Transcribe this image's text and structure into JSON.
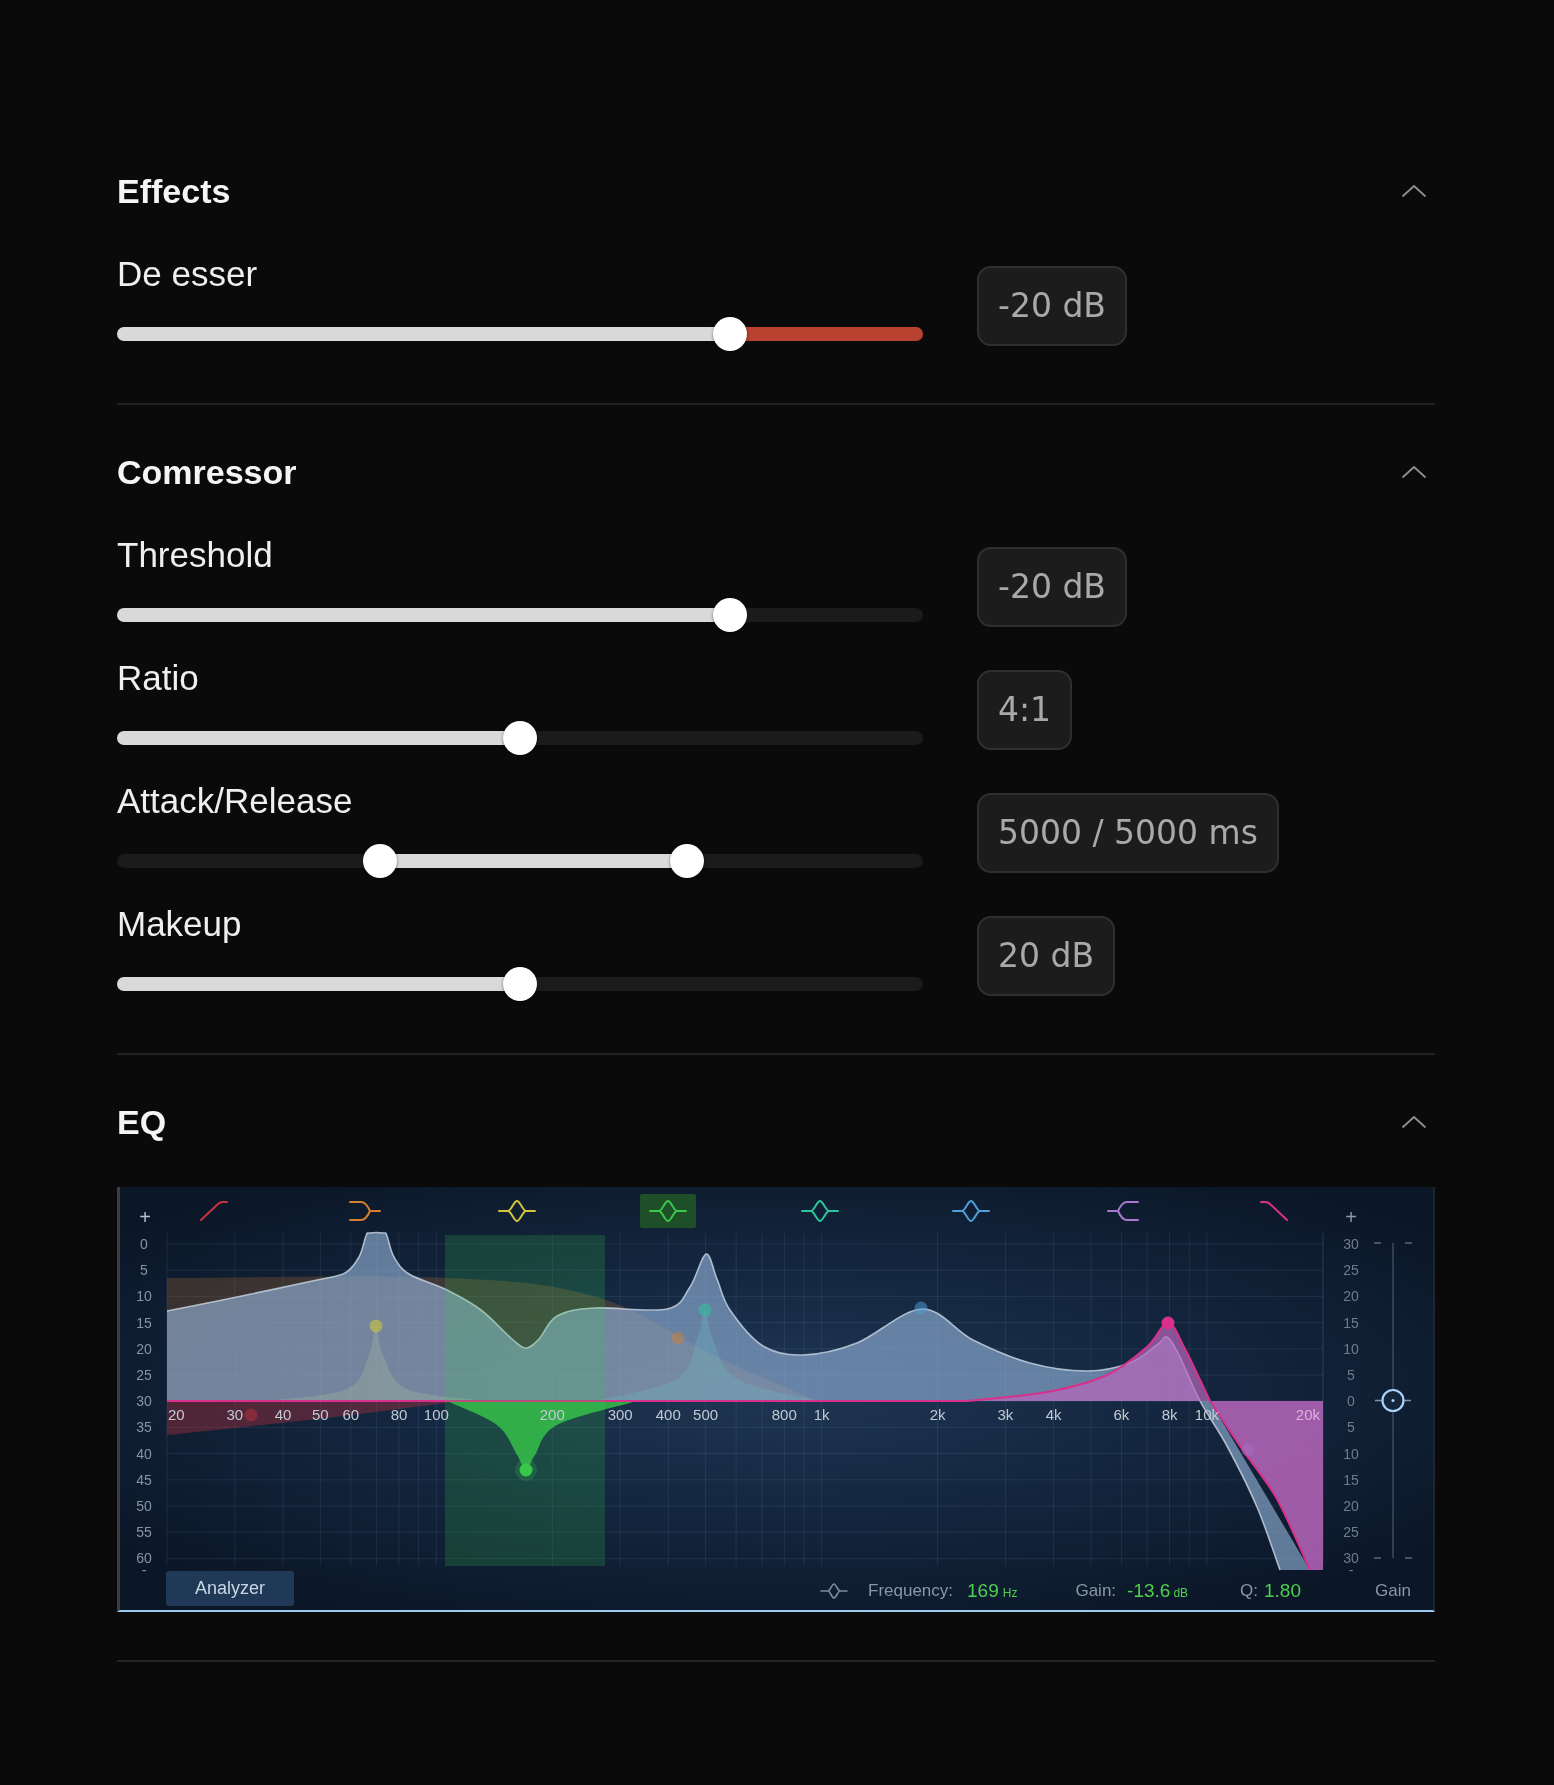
{
  "sections": [
    {
      "kind": "sliders",
      "title": "Effects",
      "expanded": true,
      "controls": [
        {
          "kind": "split",
          "label": "De esser",
          "value": "-20 dB",
          "thumbs": [
            {
              "level": 0.76
            }
          ]
        }
      ]
    },
    {
      "kind": "sliders",
      "title": "Comressor",
      "expanded": true,
      "controls": [
        {
          "kind": "single",
          "label": "Threshold",
          "value": "-20 dB",
          "thumbs": [
            {
              "level": 0.76
            }
          ]
        },
        {
          "kind": "single",
          "label": "Ratio",
          "value": "4:1",
          "thumbs": [
            {
              "level": 0.5
            }
          ]
        },
        {
          "kind": "range",
          "label": "Attack/Release",
          "value": "5000 / 5000 ms",
          "thumbs": [
            {
              "level": 0.326
            },
            {
              "level": 0.707
            }
          ]
        },
        {
          "kind": "single",
          "label": "Makeup",
          "value": "20 dB",
          "thumbs": [
            {
              "level": 0.5
            }
          ]
        }
      ]
    },
    {
      "kind": "eq",
      "title": "EQ",
      "expanded": true,
      "eq": {
        "bands": [
          {
            "kind": "low_cut",
            "color": "#c8323c",
            "selected": false
          },
          {
            "kind": "low_shelf",
            "color": "#d4802e",
            "selected": false
          },
          {
            "kind": "bell",
            "color": "#cfc63a",
            "selected": false
          },
          {
            "kind": "bell",
            "color": "#37c84a",
            "selected": true
          },
          {
            "kind": "bell",
            "color": "#2ec49c",
            "selected": false
          },
          {
            "kind": "bell",
            "color": "#4f9fd8",
            "selected": false
          },
          {
            "kind": "high_shelf",
            "color": "#a77ad0",
            "selected": false
          },
          {
            "kind": "high_cut",
            "color": "#d8308c",
            "selected": false
          }
        ],
        "db_scale": {
          "plus": "+",
          "labels": [
            "0",
            "5",
            "10",
            "15",
            "20",
            "25",
            "30",
            "35",
            "40",
            "45",
            "50",
            "55",
            "60"
          ],
          "minus": "-"
        },
        "gain_scale": {
          "plus": "+",
          "labels": [
            "30",
            "25",
            "20",
            "15",
            "10",
            "5",
            "0",
            "5",
            "10",
            "15",
            "20",
            "25",
            "30"
          ],
          "minus": "-"
        },
        "frequency_labels": [
          "20",
          "30",
          "40",
          "50",
          "60",
          "80",
          "100",
          "200",
          "300",
          "400",
          "500",
          "800",
          "1k",
          "2k",
          "3k",
          "4k",
          "6k",
          "8k",
          "10k",
          "20k"
        ],
        "analyzer_button": "Analyzer",
        "readout": {
          "frequency_label": "Frequency:",
          "frequency_value": "169",
          "frequency_unit": "Hz",
          "gain_label": "Gain:",
          "gain_value": "-13.6",
          "gain_unit": "dB",
          "q_label": "Q:",
          "q_value": "1.80"
        },
        "output_gain": {
          "label": "Gain",
          "level": 0.5
        }
      }
    }
  ]
}
